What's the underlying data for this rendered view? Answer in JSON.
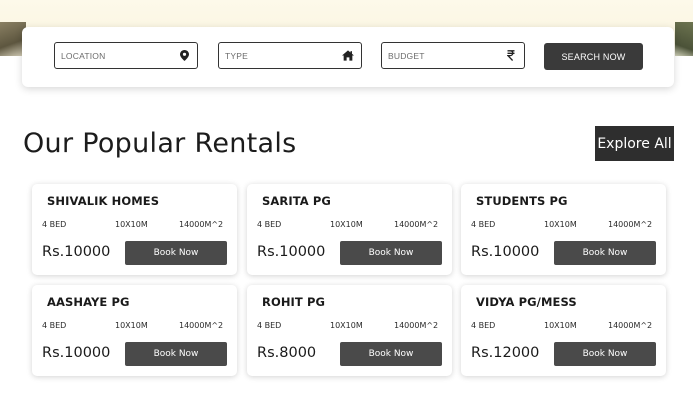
{
  "search": {
    "location_placeholder": "LOCATION",
    "type_placeholder": "TYPE",
    "budget_placeholder": "BUDGET",
    "search_button": "SEARCH NOW",
    "location_icon": "map-marker-icon",
    "type_icon": "home-icon",
    "budget_icon": "rupee-icon"
  },
  "section": {
    "title": "Our Popular Rentals",
    "explore_button": "Explore All"
  },
  "listings": [
    {
      "name": "SHIVALIK HOMES",
      "beds": "4 BED",
      "size": "10X10M",
      "area": "14000M^2",
      "price": "Rs.10000",
      "cta": "Book Now"
    },
    {
      "name": "SARITA PG",
      "beds": "4 BED",
      "size": "10X10M",
      "area": "14000M^2",
      "price": "Rs.10000",
      "cta": "Book Now"
    },
    {
      "name": "STUDENTS PG",
      "beds": "4 BED",
      "size": "10X10M",
      "area": "14000M^2",
      "price": "Rs.10000",
      "cta": "Book Now"
    },
    {
      "name": "AASHAYE PG",
      "beds": "4 BED",
      "size": "10X10M",
      "area": "14000M^2",
      "price": "Rs.10000",
      "cta": "Book Now"
    },
    {
      "name": "ROHIT PG",
      "beds": "4 BED",
      "size": "10X10M",
      "area": "14000M^2",
      "price": "Rs.8000",
      "cta": "Book Now"
    },
    {
      "name": "VIDYA PG/MESS",
      "beds": "4 BED",
      "size": "10X10M",
      "area": "14000M^2",
      "price": "Rs.12000",
      "cta": "Book Now"
    }
  ],
  "colors": {
    "button_dark": "#3a3a3a",
    "book_button": "#4a4a4a",
    "card_bg": "#ffffff"
  }
}
